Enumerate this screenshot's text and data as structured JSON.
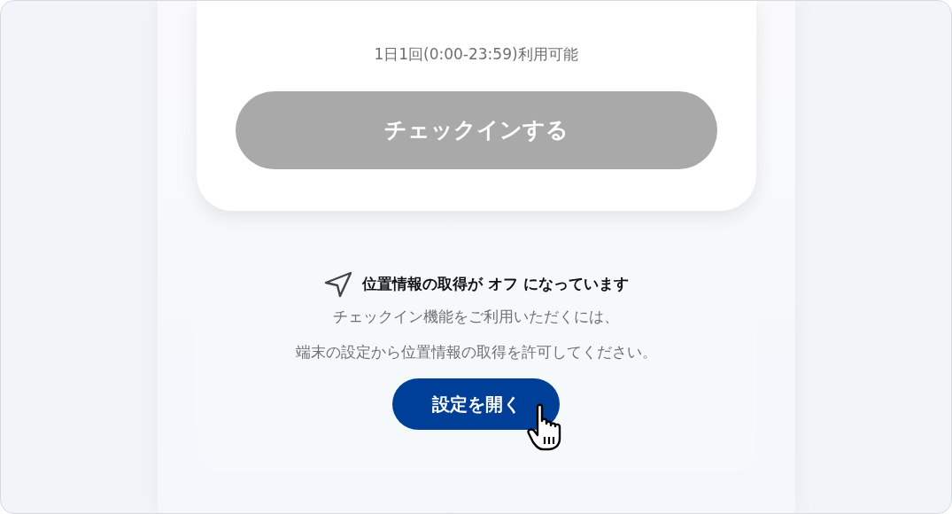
{
  "checkin_card": {
    "availability": "1日1回(0:00-23:59)利用可能",
    "button": {
      "label": "チェックインする",
      "disabled": true
    }
  },
  "location_notice": {
    "title": "位置情報の取得が **オフ** になっています",
    "message_lines": [
      "チェックイン機能をご利用いただくには、",
      "端末の設定から位置情報の取得を許可してください。"
    ],
    "button": {
      "label": "設定を開く",
      "disabled": false
    }
  }
}
